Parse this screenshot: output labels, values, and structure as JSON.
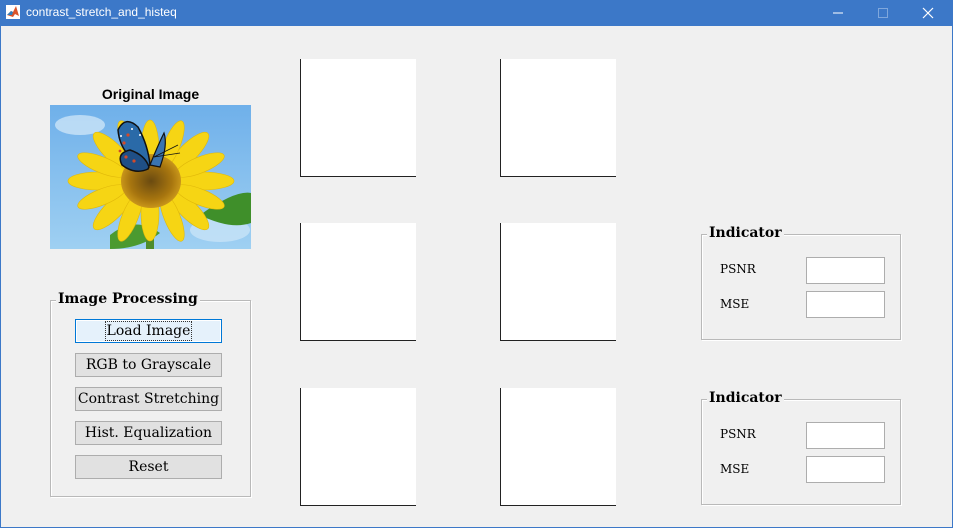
{
  "window": {
    "title": "contrast_stretch_and_histeq",
    "icon": "matlab-icon",
    "controls": [
      "minimize-icon",
      "maximize-icon",
      "close-icon"
    ]
  },
  "original": {
    "title": "Original Image",
    "image": "butterfly-on-sunflower-photo"
  },
  "image_processing": {
    "title": "Image Processing",
    "buttons": [
      "Load Image",
      "RGB to Grayscale",
      "Contrast Stretching",
      "Hist. Equalization",
      "Reset"
    ]
  },
  "indicators": [
    {
      "title": "Indicator",
      "psnr_label": "PSNR",
      "mse_label": "MSE",
      "psnr_value": "",
      "mse_value": ""
    },
    {
      "title": "Indicator",
      "psnr_label": "PSNR",
      "mse_label": "MSE",
      "psnr_value": "",
      "mse_value": ""
    }
  ],
  "colors": {
    "titlebar": "#3c78c8",
    "background": "#f0f0f0",
    "focus_border": "#0078d7"
  }
}
